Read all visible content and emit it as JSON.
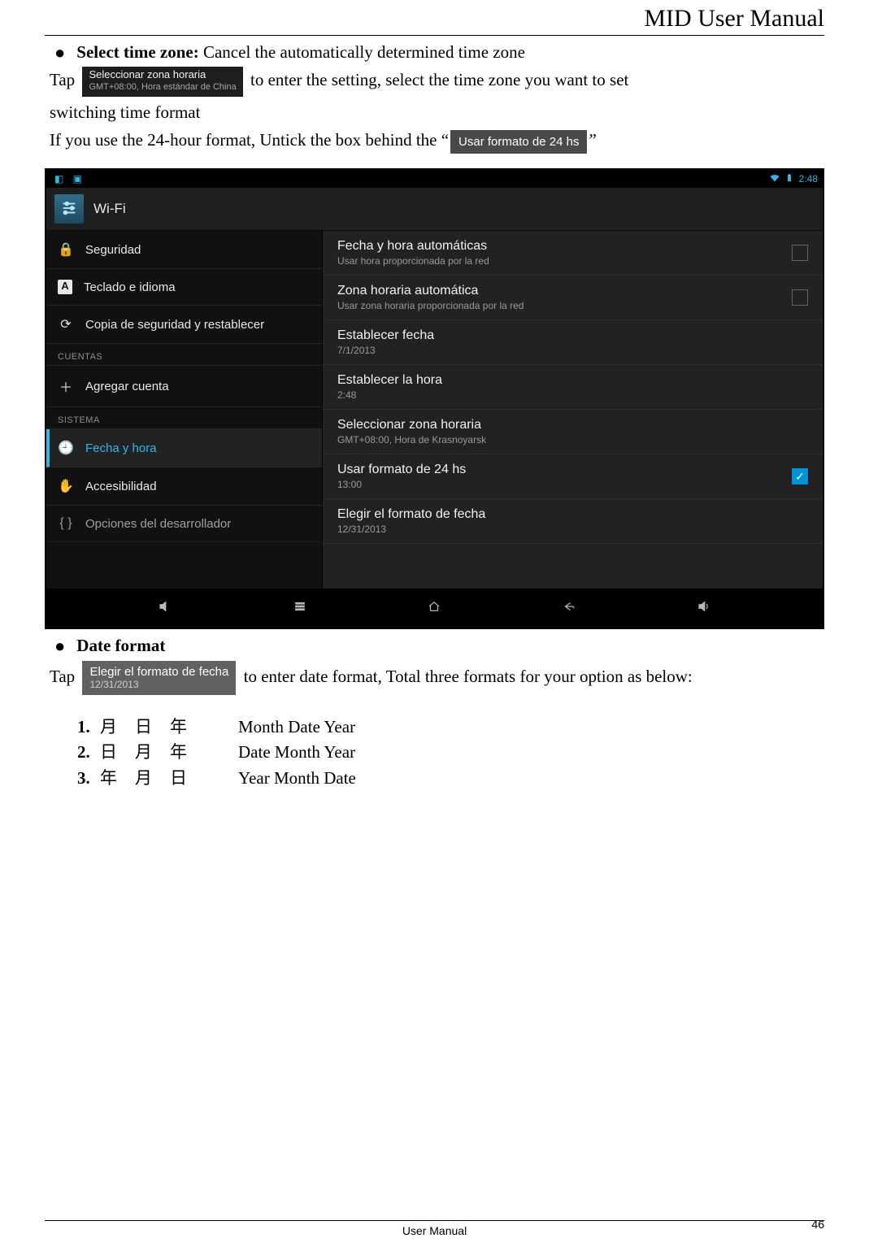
{
  "header": {
    "title": "MID User Manual"
  },
  "bullets": {
    "select_tz_label": "Select time zone:",
    "select_tz_desc": "Cancel the automatically determined time zone",
    "date_format_label": "Date format"
  },
  "para": {
    "tap1_pre": "Tap",
    "chip_tz_title": "Seleccionar zona horaria",
    "chip_tz_sub": "GMT+08:00, Hora estándar de China",
    "tap1_post": "to enter the setting, select the time zone you want to set",
    "switch_line": "switching time format",
    "untick_pre": "If you use the 24-hour format, Untick the box behind the “",
    "chip_24_label": "Usar formato de 24 hs",
    "untick_post": "”",
    "tap2_pre": "Tap",
    "chip_df_title": "Elegir el formato de fecha",
    "chip_df_sub": "12/31/2013",
    "tap2_post": "to enter date format, Total three formats for your option as below:"
  },
  "device": {
    "status_time": "2:48",
    "wifi_label": "Wi-Fi",
    "sidebar": {
      "items": [
        {
          "icon": "lock",
          "label": "Seguridad"
        },
        {
          "icon": "A",
          "label": "Teclado e idioma"
        },
        {
          "icon": "sync",
          "label": "Copia de seguridad y restablecer"
        }
      ],
      "hdr1": "CUENTAS",
      "add_account": "Agregar cuenta",
      "hdr2": "SISTEMA",
      "datetime": "Fecha y hora",
      "accessibility": "Accesibilidad",
      "dev_options": "Opciones del desarrollador"
    },
    "settings": [
      {
        "title": "Fecha y hora automáticas",
        "sub": "Usar hora proporcionada por la red",
        "chk": "empty"
      },
      {
        "title": "Zona horaria automática",
        "sub": "Usar zona horaria proporcionada por la red",
        "chk": "empty"
      },
      {
        "title": "Establecer fecha",
        "sub": "7/1/2013"
      },
      {
        "title": "Establecer la hora",
        "sub": "2:48"
      },
      {
        "title": "Seleccionar zona horaria",
        "sub": "GMT+08:00, Hora de Krasnoyarsk"
      },
      {
        "title": "Usar formato de 24 hs",
        "sub": "13:00",
        "chk": "checked"
      },
      {
        "title": "Elegir el formato de fecha",
        "sub": "12/31/2013"
      }
    ]
  },
  "formats": [
    {
      "n": "1.",
      "cjk": "月日年",
      "eng": "Month Date Year"
    },
    {
      "n": "2.",
      "cjk": "日月年",
      "eng": "Date Month Year"
    },
    {
      "n": "3.",
      "cjk": "年月日",
      "eng": "Year Month Date"
    }
  ],
  "footer": {
    "label": "User Manual",
    "page": "46"
  }
}
